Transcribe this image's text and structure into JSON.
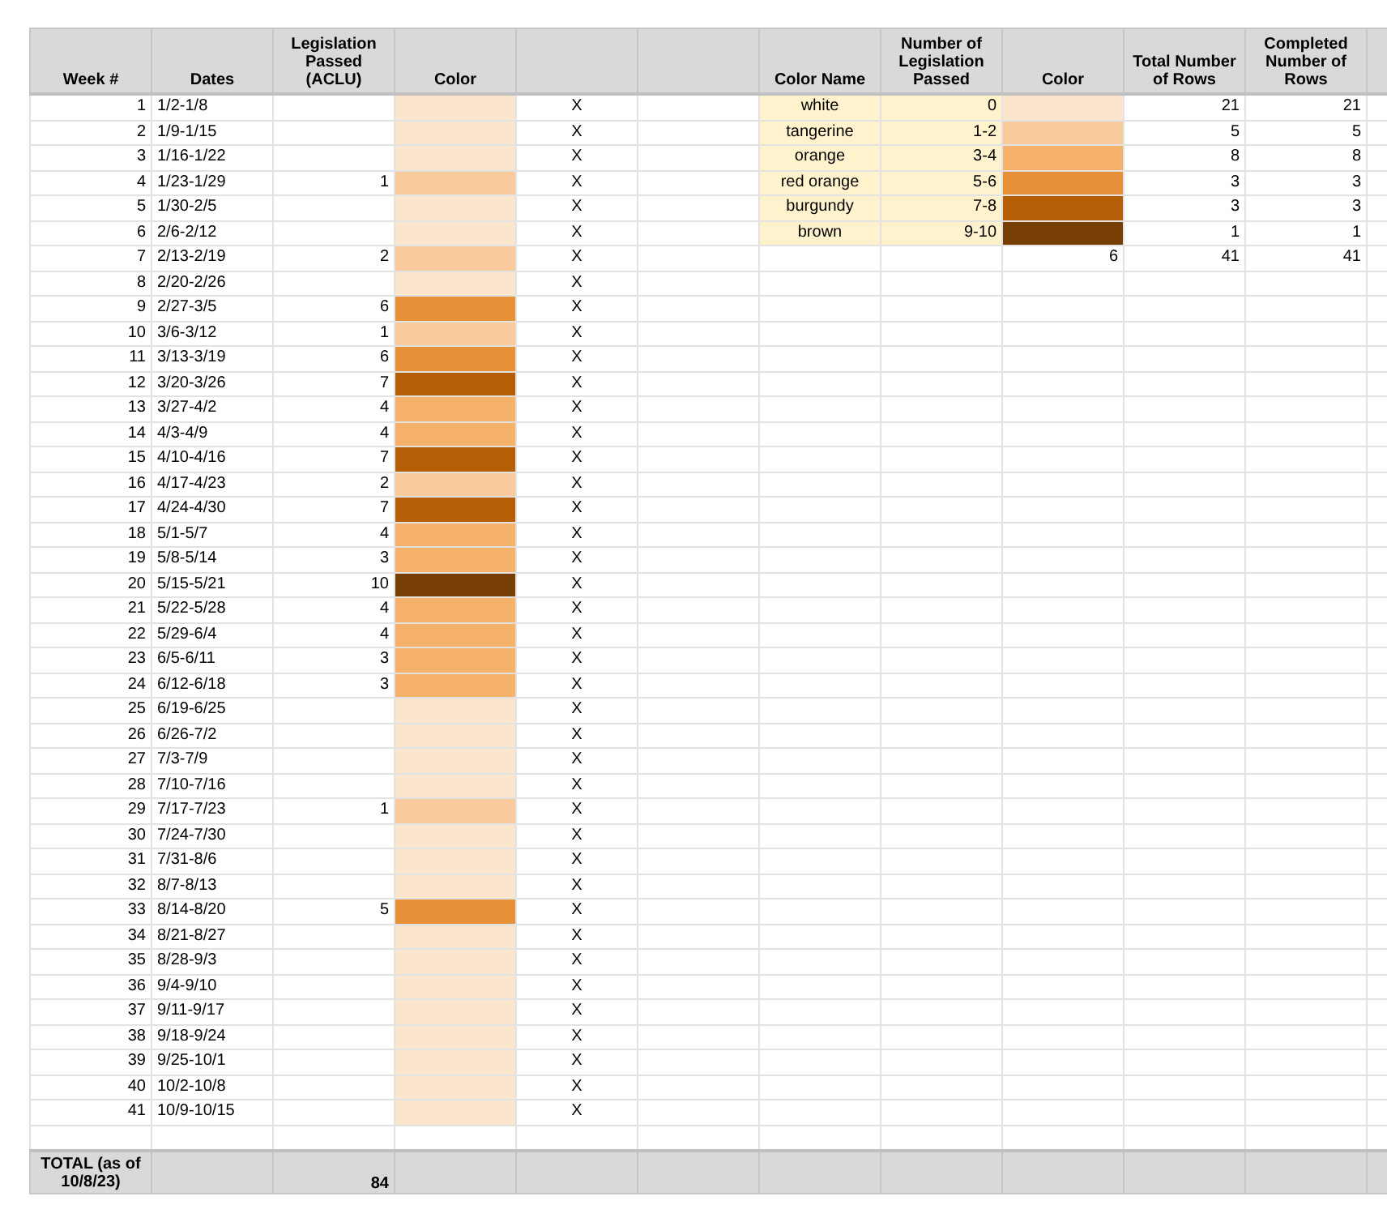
{
  "left_table": {
    "columns": [
      "Week #",
      "Dates",
      "Legislation Passed (ACLU)",
      "Color"
    ],
    "rows": [
      {
        "week": "1",
        "dates": "1/2-1/8",
        "color": "#fce5cd",
        "mark": "X"
      },
      {
        "week": "2",
        "dates": "1/9-1/15",
        "color": "#fce5cd",
        "mark": "X"
      },
      {
        "week": "3",
        "dates": "1/16-1/22",
        "color": "#fce5cd",
        "mark": "X"
      },
      {
        "week": "4",
        "dates": "1/23-1/29",
        "passed": "1",
        "color": "#f9cb9c",
        "mark": "X"
      },
      {
        "week": "5",
        "dates": "1/30-2/5",
        "color": "#fce5cd",
        "mark": "X"
      },
      {
        "week": "6",
        "dates": "2/6-2/12",
        "color": "#fce5cd",
        "mark": "X"
      },
      {
        "week": "7",
        "dates": "2/13-2/19",
        "passed": "2",
        "color": "#f9cb9c",
        "mark": "X"
      },
      {
        "week": "8",
        "dates": "2/20-2/26",
        "color": "#fce5cd",
        "mark": "X"
      },
      {
        "week": "9",
        "dates": "2/27-3/5",
        "passed": "6",
        "color": "#e69138",
        "mark": "X"
      },
      {
        "week": "10",
        "dates": "3/6-3/12",
        "passed": "1",
        "color": "#f9cb9c",
        "mark": "X"
      },
      {
        "week": "11",
        "dates": "3/13-3/19",
        "passed": "6",
        "color": "#e69138",
        "mark": "X"
      },
      {
        "week": "12",
        "dates": "3/20-3/26",
        "passed": "7",
        "color": "#b45f06",
        "mark": "X"
      },
      {
        "week": "13",
        "dates": "3/27-4/2",
        "passed": "4",
        "color": "#f6b26b",
        "mark": "X"
      },
      {
        "week": "14",
        "dates": "4/3-4/9",
        "passed": "4",
        "color": "#f6b26b",
        "mark": "X"
      },
      {
        "week": "15",
        "dates": "4/10-4/16",
        "passed": "7",
        "color": "#b45f06",
        "mark": "X"
      },
      {
        "week": "16",
        "dates": "4/17-4/23",
        "passed": "2",
        "color": "#f9cb9c",
        "mark": "X"
      },
      {
        "week": "17",
        "dates": "4/24-4/30",
        "passed": "7",
        "color": "#b45f06",
        "mark": "X"
      },
      {
        "week": "18",
        "dates": "5/1-5/7",
        "passed": "4",
        "color": "#f6b26b",
        "mark": "X"
      },
      {
        "week": "19",
        "dates": "5/8-5/14",
        "passed": "3",
        "color": "#f6b26b",
        "mark": "X"
      },
      {
        "week": "20",
        "dates": "5/15-5/21",
        "passed": "10",
        "color": "#783f04",
        "mark": "X"
      },
      {
        "week": "21",
        "dates": "5/22-5/28",
        "passed": "4",
        "color": "#f6b26b",
        "mark": "X"
      },
      {
        "week": "22",
        "dates": "5/29-6/4",
        "passed": "4",
        "color": "#f6b26b",
        "mark": "X"
      },
      {
        "week": "23",
        "dates": "6/5-6/11",
        "passed": "3",
        "color": "#f6b26b",
        "mark": "X"
      },
      {
        "week": "24",
        "dates": "6/12-6/18",
        "passed": "3",
        "color": "#f6b26b",
        "mark": "X"
      },
      {
        "week": "25",
        "dates": "6/19-6/25",
        "color": "#fce5cd",
        "mark": "X"
      },
      {
        "week": "26",
        "dates": "6/26-7/2",
        "color": "#fce5cd",
        "mark": "X"
      },
      {
        "week": "27",
        "dates": "7/3-7/9",
        "color": "#fce5cd",
        "mark": "X"
      },
      {
        "week": "28",
        "dates": "7/10-7/16",
        "color": "#fce5cd",
        "mark": "X"
      },
      {
        "week": "29",
        "dates": "7/17-7/23",
        "passed": "1",
        "color": "#f9cb9c",
        "mark": "X"
      },
      {
        "week": "30",
        "dates": "7/24-7/30",
        "color": "#fce5cd",
        "mark": "X"
      },
      {
        "week": "31",
        "dates": "7/31-8/6",
        "color": "#fce5cd",
        "mark": "X"
      },
      {
        "week": "32",
        "dates": "8/7-8/13",
        "color": "#fce5cd",
        "mark": "X"
      },
      {
        "week": "33",
        "dates": "8/14-8/20",
        "passed": "5",
        "color": "#e69138",
        "mark": "X"
      },
      {
        "week": "34",
        "dates": "8/21-8/27",
        "color": "#fce5cd",
        "mark": "X"
      },
      {
        "week": "35",
        "dates": "8/28-9/3",
        "color": "#fce5cd",
        "mark": "X"
      },
      {
        "week": "36",
        "dates": "9/4-9/10",
        "color": "#fce5cd",
        "mark": "X"
      },
      {
        "week": "37",
        "dates": "9/11-9/17",
        "color": "#fce5cd",
        "mark": "X"
      },
      {
        "week": "38",
        "dates": "9/18-9/24",
        "color": "#fce5cd",
        "mark": "X"
      },
      {
        "week": "39",
        "dates": "9/25-10/1",
        "color": "#fce5cd",
        "mark": "X"
      },
      {
        "week": "40",
        "dates": "10/2-10/8",
        "color": "#fce5cd",
        "mark": "X"
      },
      {
        "week": "41",
        "dates": "10/9-10/15",
        "color": "#fce5cd",
        "mark": "X"
      }
    ],
    "total": {
      "label": "TOTAL (as of 10/8/23)",
      "value": "84"
    }
  },
  "legend": {
    "columns": [
      "Color Name",
      "Number of Legislation Passed",
      "Color",
      "Total Number of Rows",
      "Completed Number of Rows"
    ],
    "rows": [
      {
        "name": "white",
        "range": "0",
        "color": "#fce5cd",
        "total": "21",
        "completed": "21"
      },
      {
        "name": "tangerine",
        "range": "1-2",
        "color": "#f9cb9c",
        "total": "5",
        "completed": "5"
      },
      {
        "name": "orange",
        "range": "3-4",
        "color": "#f6b26b",
        "total": "8",
        "completed": "8"
      },
      {
        "name": "red orange",
        "range": "5-6",
        "color": "#e69138",
        "total": "3",
        "completed": "3"
      },
      {
        "name": "burgundy",
        "range": "7-8",
        "color": "#b45f06",
        "total": "3",
        "completed": "3"
      },
      {
        "name": "brown",
        "range": "9-10",
        "color": "#783f04",
        "total": "1",
        "completed": "1"
      }
    ],
    "totals": {
      "colors": "6",
      "total": "41",
      "completed": "41"
    }
  }
}
